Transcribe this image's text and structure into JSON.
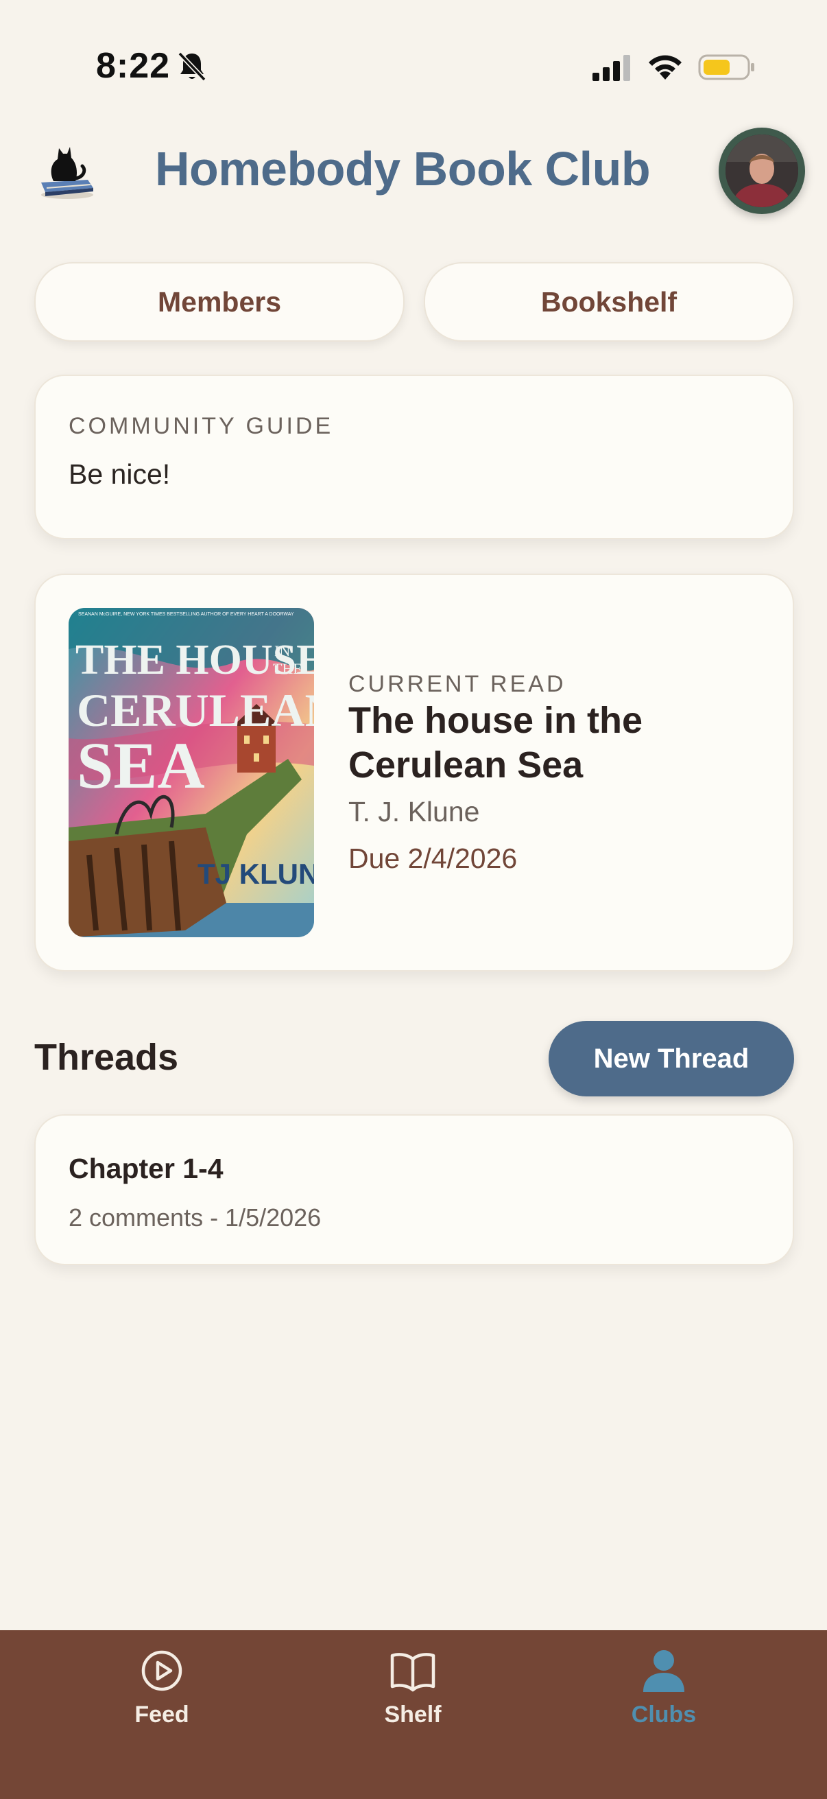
{
  "status_bar": {
    "time": "8:22",
    "battery_color": "#f5c61c"
  },
  "header": {
    "title": "Homebody Book Club"
  },
  "actions": {
    "members_label": "Members",
    "bookshelf_label": "Bookshelf"
  },
  "community_guide": {
    "heading": "COMMUNITY GUIDE",
    "text": "Be nice!"
  },
  "current_read": {
    "eyebrow": "CURRENT READ",
    "title": "The house in the Cerulean Sea",
    "author": "T. J. Klune",
    "due": "Due 2/4/2026",
    "cover_title": "THE HOUSE IN THE CERULEAN SEA",
    "cover_author": "TJ KLUNE"
  },
  "threads": {
    "heading": "Threads",
    "new_thread_label": "New Thread",
    "items": [
      {
        "title": "Chapter 1-4",
        "meta": "2 comments - 1/5/2026"
      }
    ]
  },
  "tabbar": {
    "items": [
      {
        "label": "Feed",
        "icon": "play-circle-icon"
      },
      {
        "label": "Shelf",
        "icon": "book-icon"
      },
      {
        "label": "Clubs",
        "icon": "person-icon",
        "active": true
      }
    ],
    "active_color": "#4f8fb0",
    "background": "#744636"
  },
  "colors": {
    "accent": "#4e6b8a",
    "brown": "#714638",
    "background": "#f7f3ec"
  }
}
